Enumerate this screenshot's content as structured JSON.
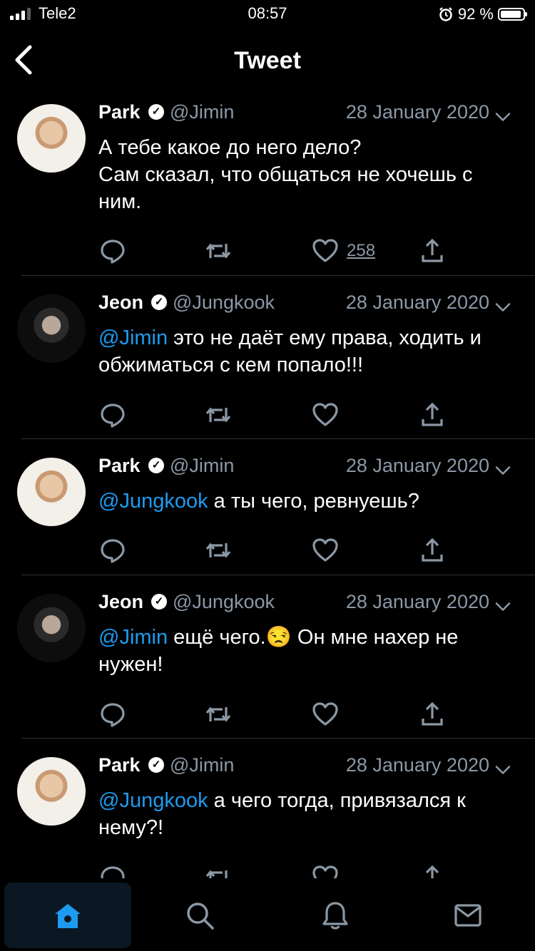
{
  "status_bar": {
    "carrier": "Tele2",
    "time": "08:57",
    "battery_text": "92 %",
    "battery_level": 0.92
  },
  "nav": {
    "title": "Tweet"
  },
  "tweets": [
    {
      "name": "Park",
      "handle": "@Jimin",
      "date": "28 January 2020",
      "mention": "",
      "text": "А тебе какое до него дело?\nСам сказал, что общаться не хочешь с ним.",
      "likes": "258"
    },
    {
      "name": "Jeon",
      "handle": "@Jungkook",
      "date": "28 January 2020",
      "mention": "@Jimin",
      "text": " это не даёт ему права, ходить и обжиматься с кем попало!!!",
      "likes": ""
    },
    {
      "name": "Park",
      "handle": "@Jimin",
      "date": "28 January 2020",
      "mention": "@Jungkook",
      "text": " а ты чего, ревнуешь?",
      "likes": ""
    },
    {
      "name": "Jeon",
      "handle": "@Jungkook",
      "date": "28 January 2020",
      "mention": "@Jimin",
      "text": " ещё чего.😒 Он мне нахер не нужен!",
      "likes": ""
    },
    {
      "name": "Park",
      "handle": "@Jimin",
      "date": "28 January 2020",
      "mention": "@Jungkook",
      "text": " а чего тогда, привязался к нему?!",
      "likes": ""
    }
  ],
  "icons": {
    "reply": "reply-icon",
    "retweet": "retweet-icon",
    "like": "heart-icon",
    "share": "share-icon",
    "home": "home-icon",
    "search": "search-icon",
    "notifications": "bell-icon",
    "messages": "mail-icon"
  },
  "colors": {
    "accent": "#1d9bf0",
    "muted": "#8b98a5",
    "divider": "#2f3336"
  }
}
